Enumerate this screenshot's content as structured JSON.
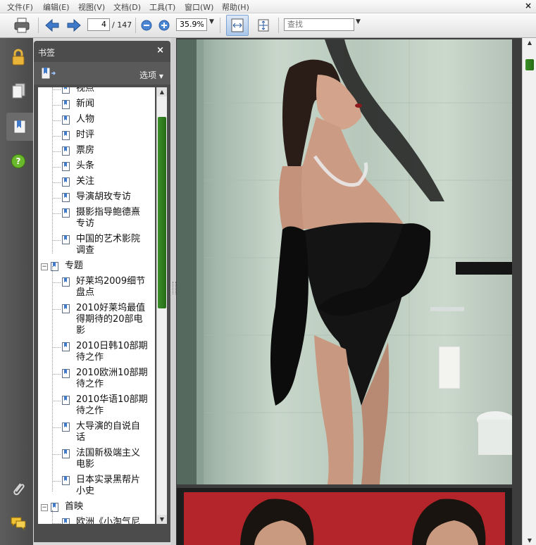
{
  "menu": {
    "items": [
      "文件(F)",
      "编辑(E)",
      "视图(V)",
      "文档(D)",
      "工具(T)",
      "窗口(W)",
      "帮助(H)"
    ],
    "close": "×"
  },
  "toolbar": {
    "page_current": "4",
    "page_total": "/ 147",
    "zoom": "35.9%",
    "find_placeholder": "查找"
  },
  "nav_rail": {
    "icons": [
      "lock-icon",
      "pages-icon",
      "bookmarks-icon",
      "help-icon",
      "attachment-icon",
      "comments-icon"
    ],
    "help_glyph": "?"
  },
  "bookmarks": {
    "title": "书签",
    "close": "×",
    "options": "选项",
    "items": [
      {
        "label": "视点",
        "level": 1
      },
      {
        "label": "新闻",
        "level": 1
      },
      {
        "label": "人物",
        "level": 1
      },
      {
        "label": "时评",
        "level": 1
      },
      {
        "label": "票房",
        "level": 1
      },
      {
        "label": "头条",
        "level": 1
      },
      {
        "label": "关注",
        "level": 1
      },
      {
        "label": "导演胡玫专访",
        "level": 1
      },
      {
        "label": "摄影指导鲍德熹",
        "label2": "专访",
        "level": 1
      },
      {
        "label": "中国的艺术影院",
        "label2": "调查",
        "level": 1
      },
      {
        "label": "专题",
        "level": 0,
        "expand": "−"
      },
      {
        "label": "好莱坞2009细节",
        "label2": "盘点",
        "level": 1
      },
      {
        "label": "2010好莱坞最值",
        "label2": "得期待的20部电",
        "label3": "影",
        "level": 1
      },
      {
        "label": "2010日韩10部期",
        "label2": "待之作",
        "level": 1
      },
      {
        "label": "2010欧洲10部期",
        "label2": "待之作",
        "level": 1
      },
      {
        "label": "2010华语10部期",
        "label2": "待之作",
        "level": 1
      },
      {
        "label": "大导演的自说自",
        "label2": "话",
        "level": 1
      },
      {
        "label": "法国新极端主义",
        "label2": "电影",
        "level": 1
      },
      {
        "label": "日本实录黑帮片",
        "label2": "小史",
        "level": 1
      },
      {
        "label": "首映",
        "level": 0,
        "expand": "−"
      },
      {
        "label": "欧洲《小淘气尼",
        "level": 1
      }
    ]
  },
  "colors": {
    "rail": "#4a4a4a",
    "panel": "#4c4c4c",
    "scroll_thumb": "#2f7d1f",
    "photo_red": "#b3252a"
  }
}
